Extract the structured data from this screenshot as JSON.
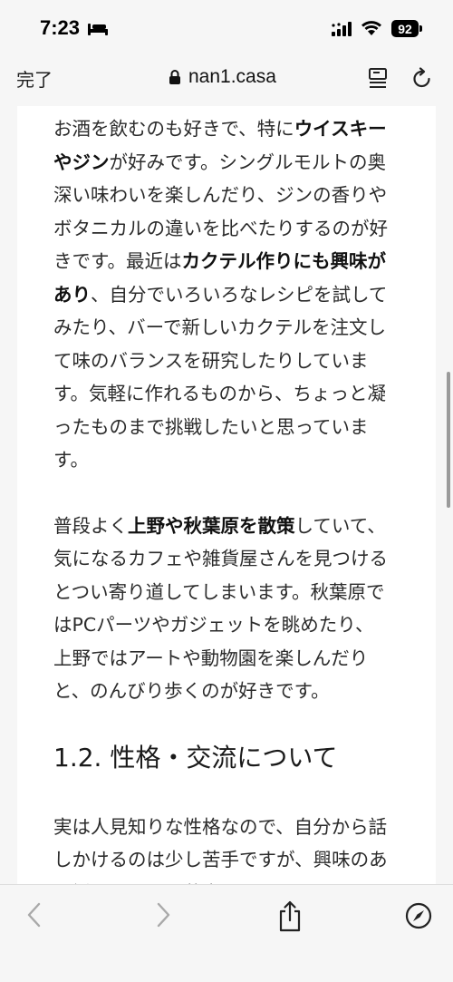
{
  "status": {
    "time": "7:23",
    "battery": "92"
  },
  "nav": {
    "done_label": "完了",
    "url": "nan1.casa"
  },
  "article": {
    "p1": [
      {
        "t": "お酒を飲むのも好きで、特に",
        "b": false
      },
      {
        "t": "ウイスキーやジン",
        "b": true
      },
      {
        "t": "が好みです。シングルモルトの奥深い味わいを楽しんだり、ジンの香りやボタニカルの違いを比べたりするのが好きです。最近は",
        "b": false
      },
      {
        "t": "カクテル作りにも興味があり",
        "b": true
      },
      {
        "t": "、自分でいろいろなレシピを試してみたり、バーで新しいカクテルを注文して味のバランスを研究したりしています。気軽に作れるものから、ちょっと凝ったものまで挑戦したいと思っています。",
        "b": false
      }
    ],
    "p2": [
      {
        "t": "普段よく",
        "b": false
      },
      {
        "t": "上野や秋葉原を散策",
        "b": true
      },
      {
        "t": "していて、気になるカフェや雑貨屋さんを見つけるとつい寄り道してしまいます。秋葉原ではPCパーツやガジェットを眺めたり、上野ではアートや動物園を楽しんだりと、のんびり歩くのが好きです。",
        "b": false
      }
    ],
    "heading": "1.2. 性格・交流について",
    "p3": "実は人見知りな性格なので、自分から話しかけるのは少し苦手ですが、興味のある話題にはつい夢中になってしまうこともあります。技術や音楽、お酒、映画や旅行の話はもちろん、好きなものについて語るのも大歓迎なので、気軽に話しか"
  },
  "toolbar": {
    "icons": [
      "back-icon",
      "forward-icon",
      "share-icon",
      "compass-icon"
    ]
  },
  "colors": {
    "chrome_bg": "#f6f6f6",
    "page_bg": "#ffffff",
    "text": "#2b2b2b"
  }
}
